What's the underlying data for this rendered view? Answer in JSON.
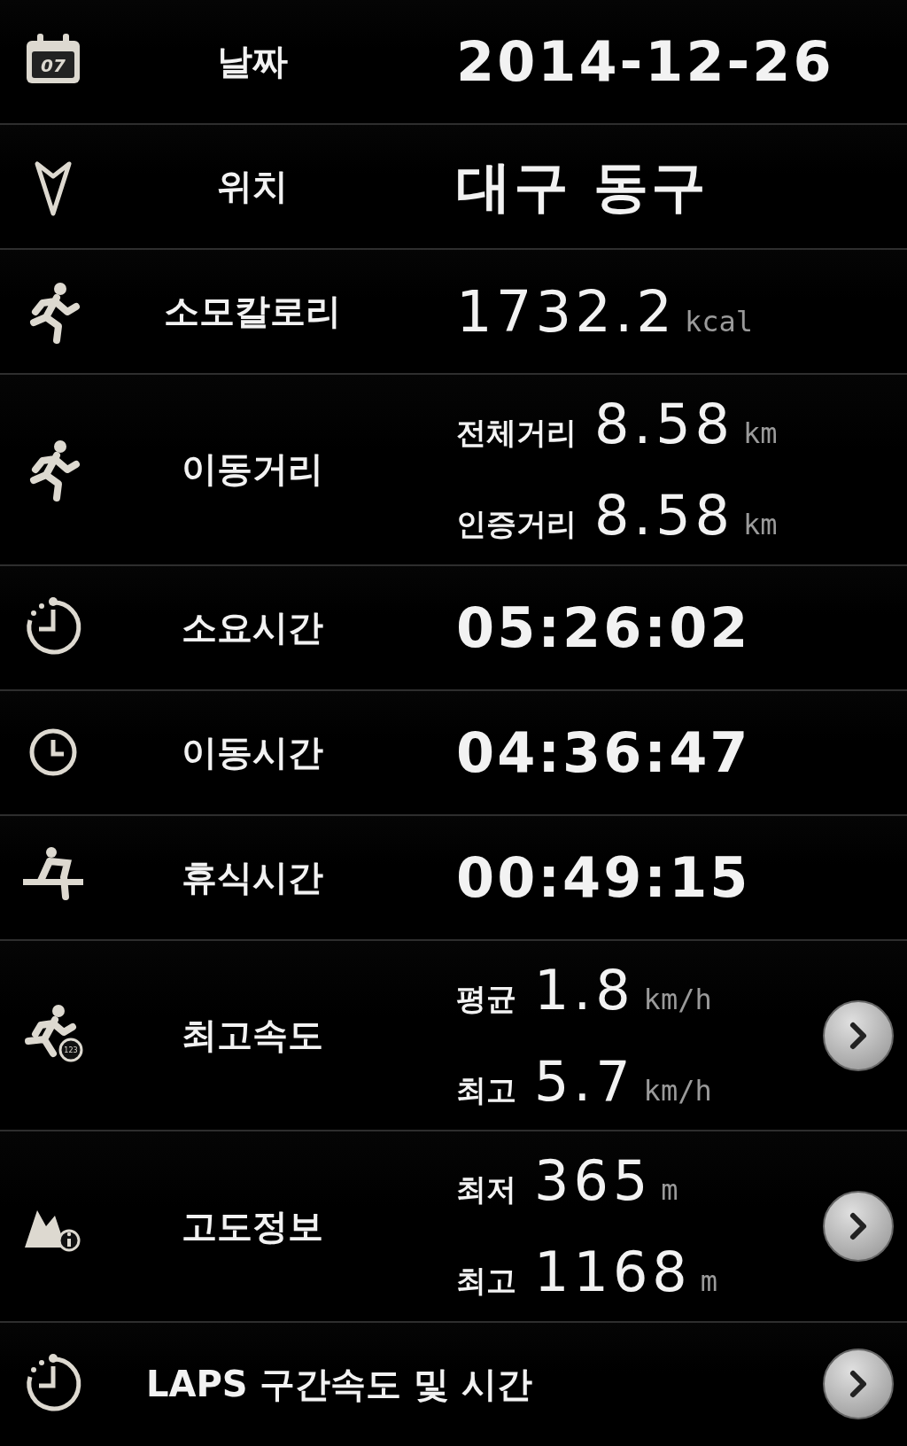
{
  "rows": [
    {
      "kind": "single",
      "label": "날짜",
      "icon_label": "07",
      "value": "2014-12-26",
      "more": false
    },
    {
      "kind": "single",
      "label": "위치",
      "value": "대구 동구",
      "more": false
    },
    {
      "kind": "single",
      "label": "소모칼로리",
      "value": "1732.2",
      "unit": "kcal",
      "more": false
    },
    {
      "kind": "pair",
      "label": "이동거리",
      "items": [
        {
          "label": "전체거리",
          "value": "8.58",
          "unit": "km"
        },
        {
          "label": "인증거리",
          "value": "8.58",
          "unit": "km"
        }
      ],
      "more": false
    },
    {
      "kind": "single",
      "label": "소요시간",
      "value": "05:26:02",
      "more": false
    },
    {
      "kind": "single",
      "label": "이동시간",
      "value": "04:36:47",
      "more": false
    },
    {
      "kind": "single",
      "label": "휴식시간",
      "value": "00:49:15",
      "more": false
    },
    {
      "kind": "pair",
      "label": "최고속도",
      "icon_label": "123",
      "items": [
        {
          "label": "평균",
          "value": "1.8",
          "unit": "km/h"
        },
        {
          "label": "최고",
          "value": "5.7",
          "unit": "km/h"
        }
      ],
      "more": true
    },
    {
      "kind": "pair",
      "label": "고도정보",
      "items": [
        {
          "label": "최저",
          "value": "365",
          "unit": "m"
        },
        {
          "label": "최고",
          "value": "1168",
          "unit": "m"
        }
      ],
      "more": true
    },
    {
      "kind": "link",
      "label": "LAPS 구간속도 및 시간",
      "more": true
    }
  ]
}
